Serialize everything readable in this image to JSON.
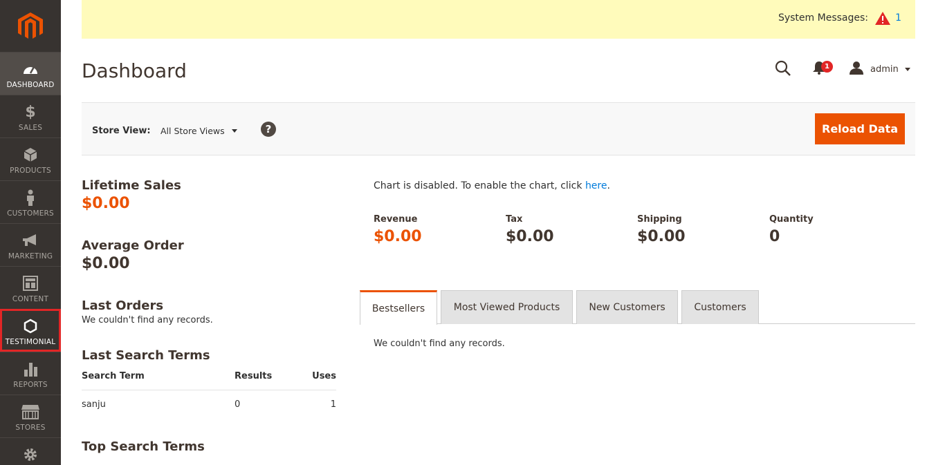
{
  "sidebar": {
    "items": [
      {
        "label": "DASHBOARD",
        "icon": "dashboard-icon"
      },
      {
        "label": "SALES",
        "icon": "dollar-icon"
      },
      {
        "label": "PRODUCTS",
        "icon": "cube-icon"
      },
      {
        "label": "CUSTOMERS",
        "icon": "person-icon"
      },
      {
        "label": "MARKETING",
        "icon": "megaphone-icon"
      },
      {
        "label": "CONTENT",
        "icon": "layout-icon"
      },
      {
        "label": "TESTIMONIAL",
        "icon": "hexagon-icon"
      },
      {
        "label": "REPORTS",
        "icon": "bar-chart-icon"
      },
      {
        "label": "STORES",
        "icon": "store-icon"
      }
    ]
  },
  "system_messages": {
    "label": "System Messages:",
    "count": "1"
  },
  "header": {
    "title": "Dashboard",
    "notification_count": "1",
    "user": "admin"
  },
  "store_view": {
    "label": "Store View:",
    "selected": "All Store Views",
    "reload_label": "Reload Data"
  },
  "stats": {
    "lifetime_sales_label": "Lifetime Sales",
    "lifetime_sales_value": "$0.00",
    "average_order_label": "Average Order",
    "average_order_value": "$0.00",
    "last_orders_label": "Last Orders",
    "last_orders_empty": "We couldn't find any records."
  },
  "last_search_terms": {
    "title": "Last Search Terms",
    "columns": [
      "Search Term",
      "Results",
      "Uses"
    ],
    "rows": [
      {
        "term": "sanju",
        "results": "0",
        "uses": "1"
      }
    ]
  },
  "top_search_terms": {
    "title": "Top Search Terms"
  },
  "chart": {
    "message": "Chart is disabled. To enable the chart, click ",
    "link": "here",
    "suffix": "."
  },
  "totals": {
    "revenue_label": "Revenue",
    "revenue_value": "$0.00",
    "tax_label": "Tax",
    "tax_value": "$0.00",
    "shipping_label": "Shipping",
    "shipping_value": "$0.00",
    "quantity_label": "Quantity",
    "quantity_value": "0"
  },
  "tabs": {
    "items": [
      "Bestsellers",
      "Most Viewed Products",
      "New Customers",
      "Customers"
    ],
    "empty": "We couldn't find any records."
  },
  "colors": {
    "accent": "#eb5202",
    "sidebar": "#373330",
    "link": "#007bdb",
    "warning": "#e22626"
  }
}
